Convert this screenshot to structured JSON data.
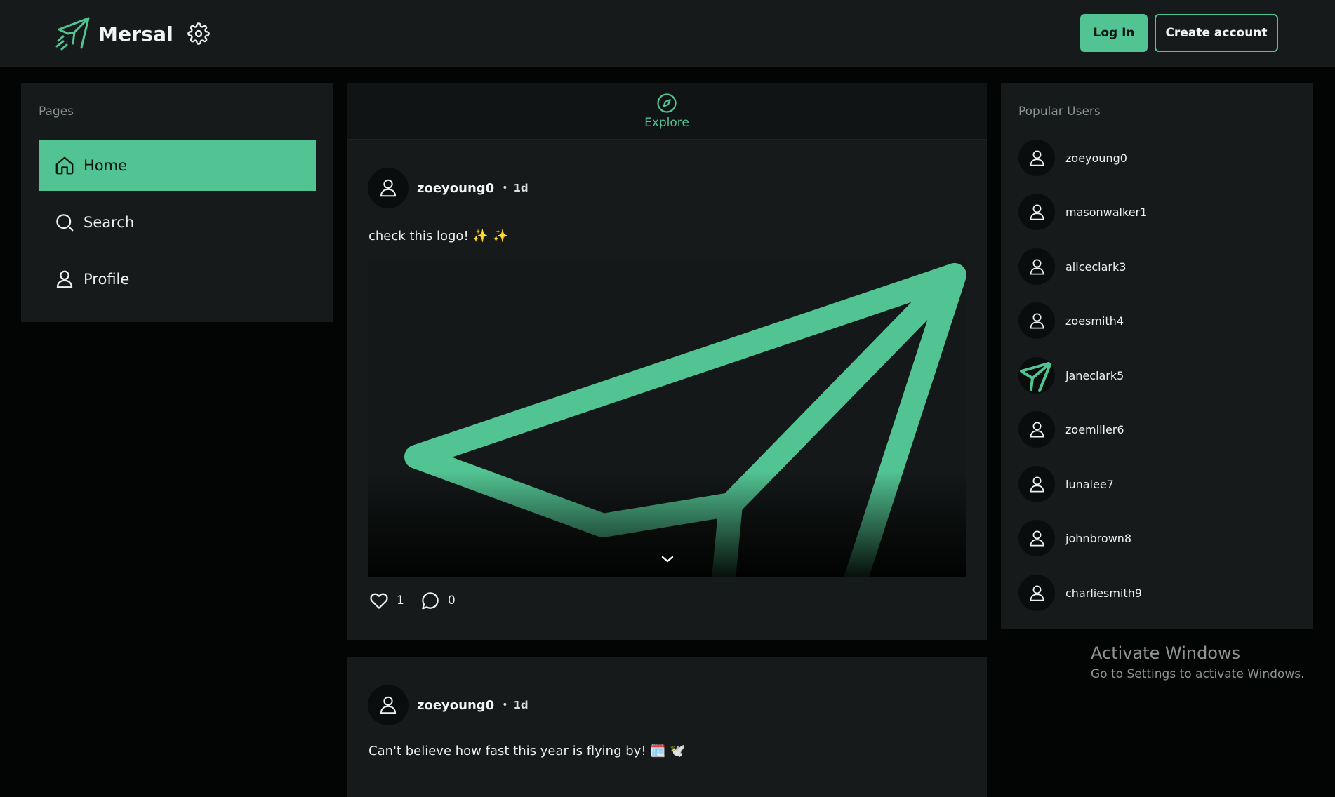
{
  "app": {
    "name": "Mersal",
    "accent_color": "#52c392",
    "icons": {
      "logo": "paper-plane-logo",
      "settings": "gear-icon"
    }
  },
  "header": {
    "login_label": "Log In",
    "create_account_label": "Create account"
  },
  "sidebar": {
    "heading": "Pages",
    "items": [
      {
        "label": "Home",
        "icon": "home-icon",
        "active": true
      },
      {
        "label": "Search",
        "icon": "search-icon",
        "active": false
      },
      {
        "label": "Profile",
        "icon": "user-icon",
        "active": false
      }
    ]
  },
  "feed": {
    "tab_label": "Explore",
    "tab_icon": "compass-icon",
    "posts": [
      {
        "username": "zoeyoung0",
        "time": "1d",
        "text": "check this logo! ✨ ✨",
        "image": "paper-plane-logo",
        "likes": "1",
        "comments": "0"
      },
      {
        "username": "zoeyoung0",
        "time": "1d",
        "text": "Can't believe how fast this year is flying by! 🗓️ 🕊️"
      }
    ]
  },
  "popular_users": {
    "heading": "Popular Users",
    "users": [
      {
        "name": "zoeyoung0",
        "avatar": "default-user"
      },
      {
        "name": "masonwalker1",
        "avatar": "default-user"
      },
      {
        "name": "aliceclark3",
        "avatar": "default-user"
      },
      {
        "name": "zoesmith4",
        "avatar": "default-user"
      },
      {
        "name": "janeclark5",
        "avatar": "paper-plane-logo"
      },
      {
        "name": "zoemiller6",
        "avatar": "default-user"
      },
      {
        "name": "lunalee7",
        "avatar": "default-user"
      },
      {
        "name": "johnbrown8",
        "avatar": "default-user"
      },
      {
        "name": "charliesmith9",
        "avatar": "default-user"
      }
    ]
  },
  "os_watermark": {
    "title": "Activate Windows",
    "subtitle": "Go to Settings to activate Windows."
  }
}
